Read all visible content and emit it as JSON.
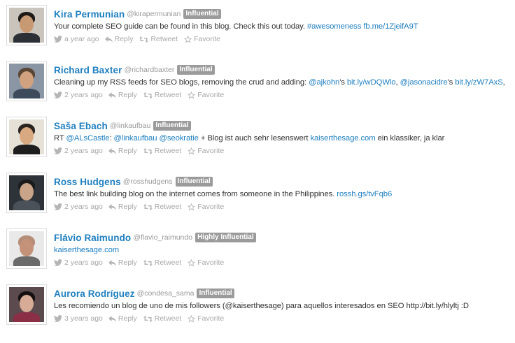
{
  "tweets": [
    {
      "name": "Kira Permunian",
      "handle": "@kirapermunian",
      "badge": "Influential",
      "text_parts": [
        {
          "t": "Your complete SEO guide can be found in this blog. Check this out today. ",
          "link": false
        },
        {
          "t": "#awesomeness",
          "link": true
        },
        {
          "t": " ",
          "link": false
        },
        {
          "t": "fb.me/1ZjeifA9T",
          "link": true
        }
      ],
      "time": "a year ago",
      "avatar": {
        "bg": "#c9c4bc",
        "skin": "#c89a74",
        "hair": "#1d1a18",
        "shirt": "#2b2f36"
      }
    },
    {
      "name": "Richard Baxter",
      "handle": "@richardbaxter",
      "badge": "Influential",
      "text_parts": [
        {
          "t": "Cleaning up my RSS feeds for SEO blogs, removing the crud and adding: ",
          "link": false
        },
        {
          "t": "@ajkohn",
          "link": true
        },
        {
          "t": "'s ",
          "link": false
        },
        {
          "t": "bit.ly/wDQWlo",
          "link": true
        },
        {
          "t": ", ",
          "link": false
        },
        {
          "t": "@jasonacidre",
          "link": true
        },
        {
          "t": "'s ",
          "link": false
        },
        {
          "t": "bit.ly/zW7AxS",
          "link": true
        },
        {
          "t": ",",
          "link": false
        }
      ],
      "time": "2 years ago",
      "avatar": {
        "bg": "#8a96a3",
        "skin": "#d1a27f",
        "hair": "#5a4634",
        "shirt": "#3d4a5c"
      }
    },
    {
      "name": "Saša Ebach",
      "handle": "@linkaufbau",
      "badge": "Influential",
      "text_parts": [
        {
          "t": "RT ",
          "link": false
        },
        {
          "t": "@ALsCastle",
          "link": true
        },
        {
          "t": ": ",
          "link": false
        },
        {
          "t": "@linkaufbau",
          "link": true
        },
        {
          "t": " ",
          "link": false
        },
        {
          "t": "@seokratie",
          "link": true
        },
        {
          "t": " + Blog ist auch sehr lesenswert ",
          "link": false
        },
        {
          "t": "kaiserthesage.com",
          "link": true
        },
        {
          "t": " ein klassiker, ja klar",
          "link": false
        }
      ],
      "time": "2 years ago",
      "avatar": {
        "bg": "#e6e1d6",
        "skin": "#d9a982",
        "hair": "#2a2420",
        "shirt": "#1e1e1e"
      }
    },
    {
      "name": "Ross Hudgens",
      "handle": "@rosshudgens",
      "badge": "Influential",
      "text_parts": [
        {
          "t": "The best link building blog on the internet comes from someone in the Philippines. ",
          "link": false
        },
        {
          "t": "rossh.gs/tvFqb6",
          "link": true
        }
      ],
      "time": "2 years ago",
      "avatar": {
        "bg": "#2d3338",
        "skin": "#c9a489",
        "hair": "#1a1a1a",
        "shirt": "#4a5158"
      }
    },
    {
      "name": "Flávio Raimundo",
      "handle": "@flavio_raimundo",
      "badge": "Highly Influential",
      "text_parts": [
        {
          "t": "kaiserthesage.com",
          "link": true
        }
      ],
      "time": "2 years ago",
      "avatar": {
        "bg": "#e9e9e9",
        "skin": "#c49278",
        "hair": "#b58d78",
        "shirt": "#6b6b6b"
      }
    },
    {
      "name": "Aurora Rodríguez",
      "handle": "@condesa_sama",
      "badge": "Influential",
      "text_parts": [
        {
          "t": "Les recomiendo un blog de uno de mis followers (@kaiserthesage) para aquellos interesados en SEO http://bit.ly/hlyltj :D",
          "link": false
        }
      ],
      "time": "3 years ago",
      "avatar": {
        "bg": "#5c4b4e",
        "skin": "#d7ab96",
        "hair": "#160f10",
        "shirt": "#8a2f46"
      }
    }
  ],
  "actions": {
    "reply": "Reply",
    "retweet": "Retweet",
    "favorite": "Favorite"
  },
  "colors": {
    "name": "#1f7fbf",
    "link": "#1f7fbf",
    "badge_bg": "#9b9b9b",
    "muted": "#a8a8a8"
  },
  "icons": [
    "bird-icon",
    "reply-icon",
    "retweet-icon",
    "star-icon"
  ]
}
